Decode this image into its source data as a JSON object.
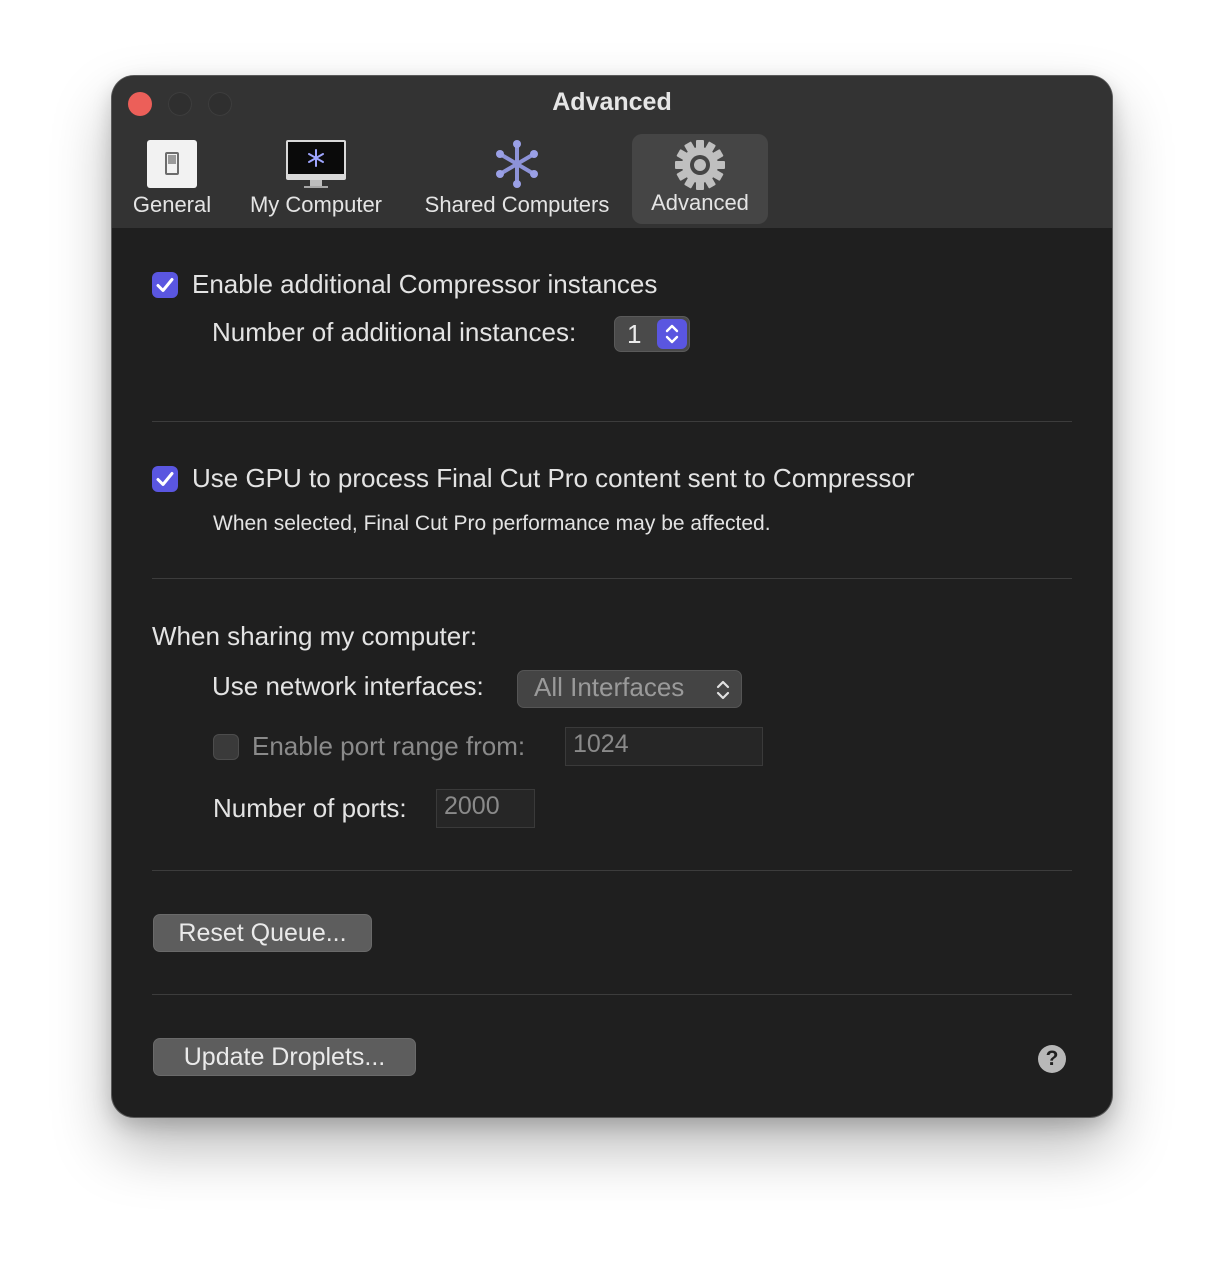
{
  "window": {
    "title": "Advanced"
  },
  "tabs": [
    {
      "label": "General",
      "icon": "general-switch-icon"
    },
    {
      "label": "My Computer",
      "icon": "imac-icon"
    },
    {
      "label": "Shared Computers",
      "icon": "asterisk-network-icon"
    },
    {
      "label": "Advanced",
      "icon": "gear-icon",
      "selected": true
    }
  ],
  "instances": {
    "checkbox_label": "Enable additional Compressor instances",
    "checked": true,
    "count_label": "Number of additional instances:",
    "count_value": "1"
  },
  "gpu": {
    "checkbox_label": "Use GPU to process Final Cut Pro content sent to Compressor",
    "checked": true,
    "note": "When selected, Final Cut Pro performance may be affected."
  },
  "sharing": {
    "heading": "When sharing my computer:",
    "network_label": "Use network interfaces:",
    "network_value": "All Interfaces",
    "port_range_label": "Enable port range from:",
    "port_range_checked": false,
    "port_range_value": "1024",
    "ports_label": "Number of ports:",
    "ports_value": "2000"
  },
  "buttons": {
    "reset_queue": "Reset Queue...",
    "update_droplets": "Update Droplets...",
    "help": "?"
  },
  "colors": {
    "accent": "#5a56e0",
    "close": "#ec5f59",
    "window_bg": "#1f1f1f",
    "titlebar_bg": "#333333"
  }
}
